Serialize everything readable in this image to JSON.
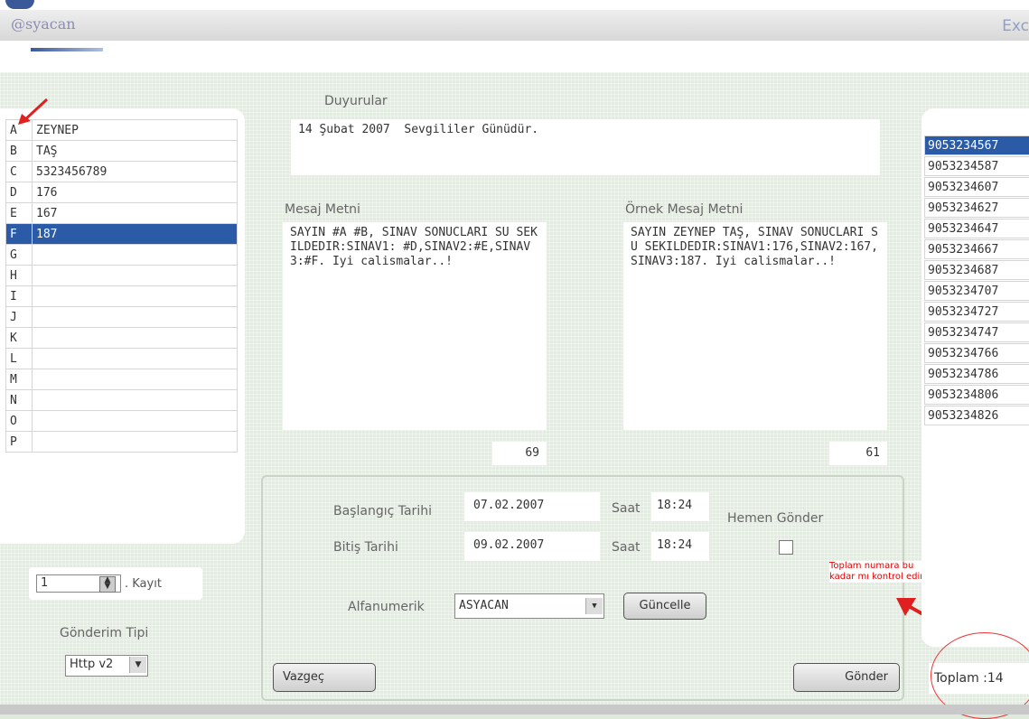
{
  "header": {
    "brand": "@syacan",
    "brand_right": "Exc"
  },
  "letters": [
    {
      "letter": "A",
      "value": "ZEYNEP"
    },
    {
      "letter": "B",
      "value": "TAŞ"
    },
    {
      "letter": "C",
      "value": "5323456789"
    },
    {
      "letter": "D",
      "value": "176"
    },
    {
      "letter": "E",
      "value": "167"
    },
    {
      "letter": "F",
      "value": "187"
    },
    {
      "letter": "G",
      "value": ""
    },
    {
      "letter": "H",
      "value": ""
    },
    {
      "letter": "I",
      "value": ""
    },
    {
      "letter": "J",
      "value": ""
    },
    {
      "letter": "K",
      "value": ""
    },
    {
      "letter": "L",
      "value": ""
    },
    {
      "letter": "M",
      "value": ""
    },
    {
      "letter": "N",
      "value": ""
    },
    {
      "letter": "O",
      "value": ""
    },
    {
      "letter": "P",
      "value": ""
    }
  ],
  "selected_letter_index": 5,
  "record": {
    "value": "1",
    "label": ". Kayıt"
  },
  "send_type": {
    "label": "Gönderim Tipi",
    "value": "Http v2"
  },
  "announcements": {
    "label": "Duyurular",
    "text": "14 Şubat 2007  Sevgililer Günüdür."
  },
  "message": {
    "label": "Mesaj Metni",
    "text": "SAYIN #A #B, SINAV SONUCLARI SU SEKILDEDIR:SINAV1: #D,SINAV2:#E,SINAV3:#F. Iyi calismalar..!",
    "count": "69"
  },
  "sample": {
    "label": "Örnek Mesaj Metni",
    "text": "SAYIN ZEYNEP TAŞ, SINAV SONUCLARI SU SEKILDEDIR:SINAV1:176,SINAV2:167,SINAV3:187. Iyi calismalar..!",
    "count": "61"
  },
  "schedule": {
    "start_label": "Başlangıç Tarihi",
    "start_date": "07.02.2007",
    "end_label": "Bitiş Tarihi",
    "end_date": "09.02.2007",
    "time_label": "Saat",
    "start_time": "18:24",
    "end_time": "18:24",
    "send_now_label": "Hemen Gönder"
  },
  "alphanumeric": {
    "label": "Alfanumerik",
    "value": "ASYACAN",
    "update_label": "Güncelle"
  },
  "buttons": {
    "cancel": "Vazgeç",
    "send": "Gönder"
  },
  "note": "Toplam numara bu\nkadar mı kontrol edin",
  "phones": [
    "9053234567",
    "9053234587",
    "9053234607",
    "9053234627",
    "9053234647",
    "9053234667",
    "9053234687",
    "9053234707",
    "9053234727",
    "9053234747",
    "9053234766",
    "9053234786",
    "9053234806",
    "9053234826"
  ],
  "selected_phone_index": 0,
  "total": "Toplam :14",
  "colors": {
    "selection": "#2b5aa6",
    "annotation": "#e00000",
    "panel_bg": "#e2ecdf"
  }
}
